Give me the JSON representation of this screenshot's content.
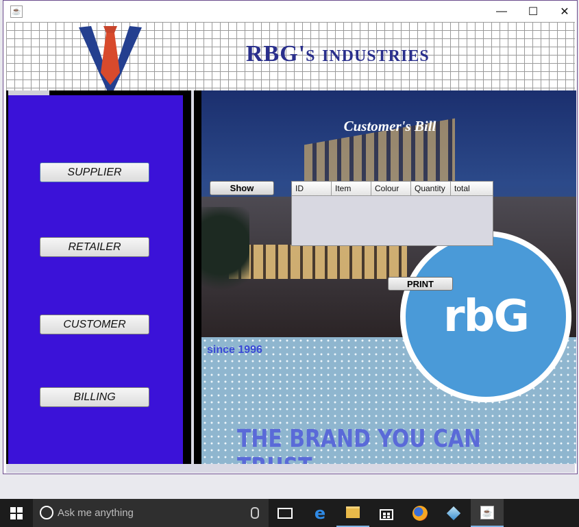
{
  "window": {
    "title": "",
    "controls": {
      "minimize": "—",
      "maximize": "☐",
      "close": "✕"
    }
  },
  "header": {
    "brand_name": "RBG's industries"
  },
  "sidebar": {
    "items": [
      {
        "label": "SUPPLIER"
      },
      {
        "label": "RETAILER"
      },
      {
        "label": "CUSTOMER"
      },
      {
        "label": "BILLING"
      }
    ]
  },
  "main": {
    "title": "Customer's Bill",
    "show_button": "Show",
    "print_button": "PRINT",
    "table": {
      "columns": [
        "ID",
        "Item",
        "Colour",
        "Quantity",
        "total"
      ],
      "rows": []
    },
    "since_text": "since 1996",
    "slogan": "THE BRAND YOU CAN TRUST",
    "logo_text": "rbG"
  },
  "colors": {
    "sidebar_bg": "#3b12d8",
    "brand_text": "#2a2f8c",
    "logo_circle": "#4a9ad8",
    "slogan": "#5a6ad8"
  },
  "taskbar": {
    "search_placeholder": "Ask me anything",
    "icons": [
      "windows-start-icon",
      "cortana-icon",
      "microphone-icon",
      "task-view-icon",
      "edge-icon",
      "file-explorer-icon",
      "store-icon",
      "firefox-icon",
      "virtualbox-icon",
      "java-icon"
    ]
  }
}
